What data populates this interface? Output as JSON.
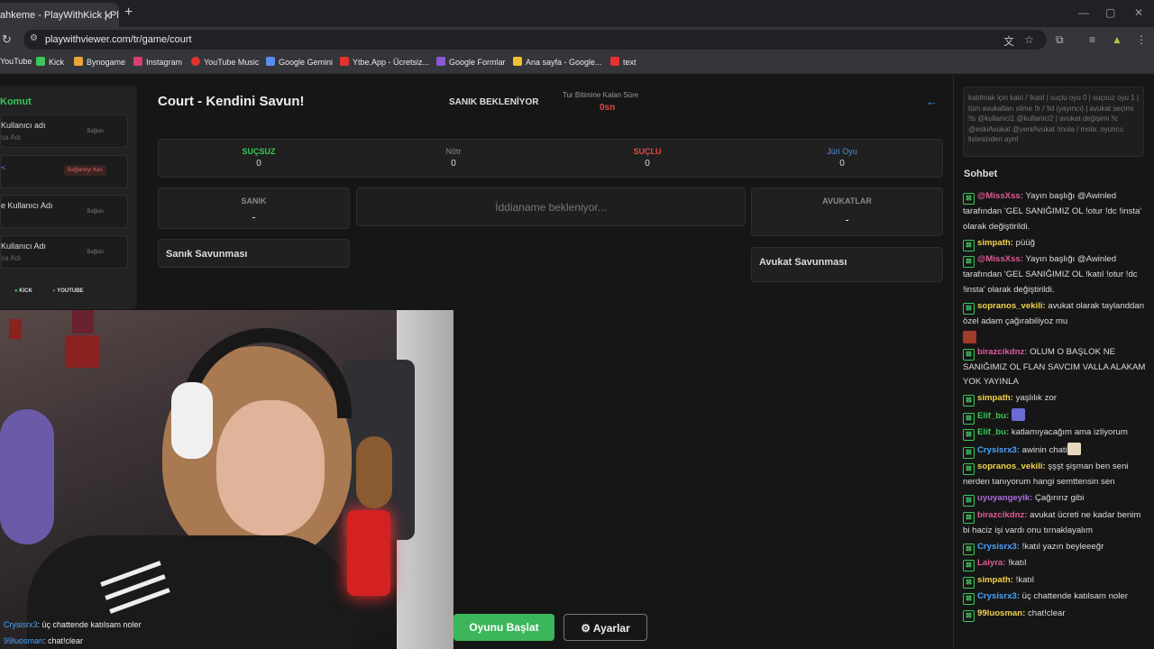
{
  "browser": {
    "tab_title": "ahkeme - PlayWithKick | Play",
    "url": "playwithviewer.com/tr/game/court",
    "bookmarks": [
      "YouTube",
      "Kick",
      "Bynogame",
      "Instagram",
      "YouTube Music",
      "Google Gemini",
      "Ytbe.App - Ücretsiz...",
      "Google Formlar",
      "Ana sayfa - Google...",
      "text"
    ]
  },
  "left_panel": {
    "title": "Komut",
    "cards": [
      {
        "label": "Kullanıcı adı",
        "sub": "sa Adı",
        "button": "Bağlan"
      },
      {
        "label": "<",
        "sub": "",
        "button": "Bağlantıyı Kes"
      },
      {
        "label": "e Kullanıcı Adı",
        "sub": "",
        "button": "Bağlan"
      },
      {
        "label": "Kullanıcı Adı",
        "sub": "sa Adı",
        "button": "Bağlan"
      }
    ],
    "tags": [
      "KICK",
      "YOUTUBE"
    ]
  },
  "game": {
    "title": "Court - Kendini Savun!",
    "status": "SANIK BEKLENİYOR",
    "timer_label": "Tur Bitimine Kalan Süre",
    "timer_value": "0sn",
    "votes": [
      {
        "label": "SUÇSUZ",
        "value": "0",
        "color": "#3cc65a"
      },
      {
        "label": "Nötr",
        "value": "0",
        "color": "#888888"
      },
      {
        "label": "SUÇLU",
        "value": "0",
        "color": "#e54848"
      },
      {
        "label": "Jüri Oyu",
        "value": "0",
        "color": "#4a90e2"
      }
    ],
    "defendant_header": "SANIK",
    "defendant_value": "-",
    "indictment_placeholder": "İddianame bekleniyor...",
    "lawyers_header": "AVUKATLAR",
    "lawyers_value": "-",
    "defendant_defense": "Sanık Savunması",
    "lawyer_defense": "Avukat Savunması",
    "start_button": "Oyunu Başlat",
    "settings_button": "Ayarlar"
  },
  "webcam_chat": [
    {
      "user": "Crysisrx3",
      "text": ": üç chattende katılsam noler"
    },
    {
      "user": "99luosman",
      "text": ": chat!clear"
    }
  ],
  "commands_text": "katılmak için katıl / !katıl | suçlu oyu 0 | suçsuz oyu 1 | tüm avukatları silme !lr / !ld (yayıncı) | avukat seçimi !ls @kullanici1 @kullanici2 | avukat değişimi !lc @eskiAvukat @yeniAvukat !mola / mola: oyuncu listesinden ayrıl",
  "chat_title": "Sohbet",
  "chat": [
    {
      "user": "@MissXss:",
      "color": "#e05a9a",
      "text": " Yayın başlığı @Awinled tarafından 'GEL SANIĞIMIZ OL !otur !dc !insta' olarak değiştirildi."
    },
    {
      "user": "simpath:",
      "color": "#f2d24c",
      "text": " püüğ"
    },
    {
      "user": "@MissXss:",
      "color": "#e05a9a",
      "text": " Yayın başlığı @Awinled tarafından 'GEL SANIĞIMIZ OL !katıl !otur !dc !insta' olarak değiştirildi."
    },
    {
      "user": "sopranos_vekili:",
      "color": "#f2d24c",
      "text": " avukat olarak taylanddan özel adam çağırabiliyoz mu",
      "emote": "#a03a2a"
    },
    {
      "user": "birazcikdnz:",
      "color": "#e05a9a",
      "text": " OLUM O BAŞLOK NE SANIĞIMIZ OL FLAN SAVCIM VALLA ALAKAM YOK YAYINLA"
    },
    {
      "user": "simpath:",
      "color": "#f2d24c",
      "text": " yaşlılık zor"
    },
    {
      "user": "Elif_bu:",
      "color": "#3cc65a",
      "text": " ",
      "emote": "#6b6bd6"
    },
    {
      "user": "Elif_bu:",
      "color": "#3cc65a",
      "text": " katlamıyacağım ama izliyorum"
    },
    {
      "user": "Crysisrx3:",
      "color": "#4aa3ff",
      "text": " awinin chati",
      "emote": "#e8d8c0"
    },
    {
      "user": "sopranos_vekili:",
      "color": "#f2d24c",
      "text": " şşşt şişman ben seni nerden tanıyorum hangi semttensin sen"
    },
    {
      "user": "uyuyangeyik:",
      "color": "#b06adf",
      "text": " Çağırırız gibi"
    },
    {
      "user": "birazcikdnz:",
      "color": "#e05a9a",
      "text": " avukat ücreti ne kadar benim bi haciz işi vardı onu tırnaklayalım"
    },
    {
      "user": "Crysisrx3:",
      "color": "#4aa3ff",
      "text": " !katıl yazın beyleeeğr"
    },
    {
      "user": "Laiyra:",
      "color": "#e05a9a",
      "text": " !katıl"
    },
    {
      "user": "simpath:",
      "color": "#f2d24c",
      "text": " !katıl"
    },
    {
      "user": "Crysisrx3:",
      "color": "#4aa3ff",
      "text": " üç chattende katılsam noler"
    },
    {
      "user": "99luosman:",
      "color": "#f2d24c",
      "text": " chat!clear"
    }
  ]
}
